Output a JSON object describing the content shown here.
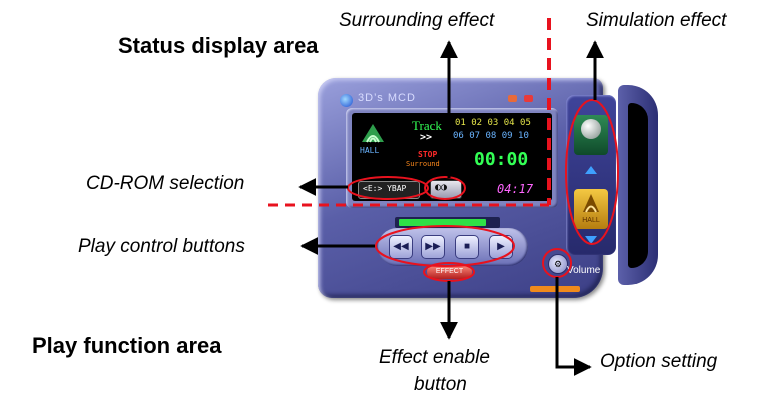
{
  "area_titles": {
    "status": "Status display area",
    "play": "Play function area"
  },
  "callouts": {
    "surrounding": "Surrounding effect",
    "simulation": "Simulation effect",
    "cdrom": "CD-ROM selection",
    "play_controls": "Play control buttons",
    "effect_line1": "Effect enable",
    "effect_line2": "button",
    "option": "Option setting"
  },
  "player": {
    "app_title": "3D’s MCD",
    "effect_icon_label": "HALL",
    "track_label": "Track",
    "track_numbers_row1": "01 02 03 04 05",
    "track_numbers_row2": "06 07 08 09 10",
    "next_symbol": ">>",
    "status": "STOP",
    "surround_label": "Surround",
    "time_display": "00:00",
    "cd_drive": "<E:> YBAP",
    "surround_button": "◐◑",
    "total_time": "04:17",
    "play_buttons": [
      "◀◀",
      "▶▶",
      "■",
      "▶"
    ],
    "effect_button": "EFFECT",
    "option_button": "⚙",
    "simulation_hall": "HALL",
    "volume_label": "Volume",
    "progress_fraction": 0.9
  },
  "colors": {
    "divider": "#e8121e",
    "arrow": "#000000",
    "highlight": "#e8121e",
    "track_text": "#33ff55",
    "time_text": "#33ff55",
    "status_text": "#ff2a2a",
    "total_time_text": "#ff66ff"
  },
  "icons": {
    "logo": "app-logo-icon",
    "hall": "hall-effect-icon",
    "option": "gear-icon"
  }
}
